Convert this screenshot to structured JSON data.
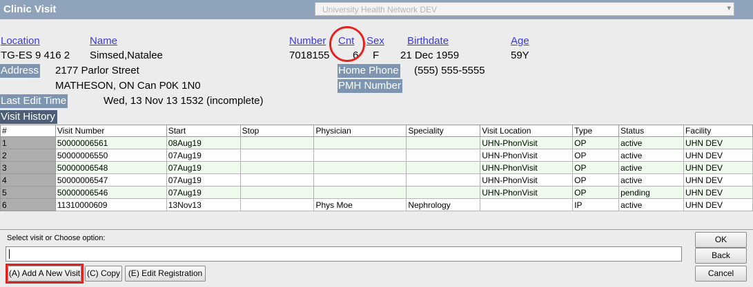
{
  "window": {
    "title": "Clinic Visit",
    "environment": "University Health Network DEV",
    "env_arrow": "▾"
  },
  "patient": {
    "labels": {
      "location": "Location",
      "name": "Name",
      "number": "Number",
      "cnt": "Cnt",
      "sex": "Sex",
      "birthdate": "Birthdate",
      "age": "Age"
    },
    "location": "TG-ES 9 416 2",
    "name": "Simsed,Natalee",
    "number": "7018155",
    "cnt": "6",
    "sex": "F",
    "birthdate": "21 Dec 1959",
    "age": "59Y",
    "address_label": "Address",
    "address_line1": "2177 Parlor Street",
    "address_line2": "MATHESON, ON  Can  P0K 1N0",
    "home_phone_label": "Home Phone",
    "home_phone": "(555) 555-5555",
    "pmh_label": "PMH Number",
    "last_edit_label": "Last Edit Time",
    "last_edit_value": "Wed, 13 Nov 13  1532 (incomplete)"
  },
  "visit_history": {
    "label": "Visit History",
    "columns": [
      "#",
      "Visit Number",
      "Start",
      "Stop",
      "Physician",
      "Speciality",
      "Visit Location",
      "Type",
      "Status",
      "Facility"
    ],
    "rows": [
      [
        "1",
        "50000006561",
        "08Aug19",
        "",
        "",
        "",
        "UHN-PhonVisit",
        "OP",
        "active",
        "UHN DEV"
      ],
      [
        "2",
        "50000006550",
        "07Aug19",
        "",
        "",
        "",
        "UHN-PhonVisit",
        "OP",
        "active",
        "UHN DEV"
      ],
      [
        "3",
        "50000006548",
        "07Aug19",
        "",
        "",
        "",
        "UHN-PhonVisit",
        "OP",
        "active",
        "UHN DEV"
      ],
      [
        "4",
        "50000006547",
        "07Aug19",
        "",
        "",
        "",
        "UHN-PhonVisit",
        "OP",
        "active",
        "UHN DEV"
      ],
      [
        "5",
        "50000006546",
        "07Aug19",
        "",
        "",
        "",
        "UHN-PhonVisit",
        "OP",
        "pending",
        "UHN DEV"
      ],
      [
        "6",
        "11310000609",
        "13Nov13",
        "",
        "Phys Moe",
        "Nephrology",
        "",
        "IP",
        "active",
        "UHN DEV"
      ]
    ]
  },
  "command": {
    "prompt": "Select visit or Choose option:",
    "value": ""
  },
  "buttons": {
    "add_new_visit": "(A) Add A New Visit",
    "copy": "(C) Copy",
    "edit_registration": "(E) Edit Registration",
    "ok": "OK",
    "back": "Back",
    "cancel": "Cancel"
  }
}
